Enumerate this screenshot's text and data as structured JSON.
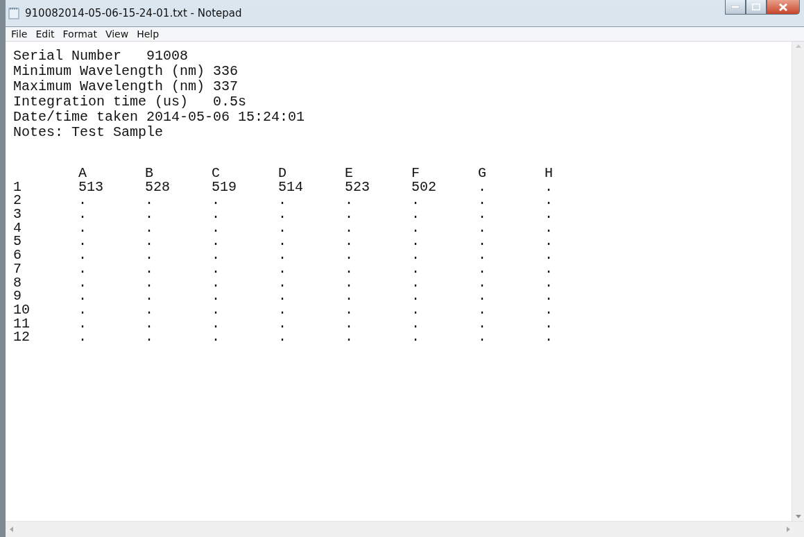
{
  "window": {
    "title": "910082014-05-06-15-24-01.txt - Notepad"
  },
  "menu": [
    "File",
    "Edit",
    "Format",
    "View",
    "Help"
  ],
  "document": {
    "lines": [
      "Serial Number   91008",
      "Minimum Wavelength (nm) 336",
      "Maximum Wavelength (nm) 337",
      "Integration time (us)   0.5s",
      "Date/time taken 2014-05-06 15:24:01",
      "Notes: Test Sample"
    ],
    "table": {
      "columns": [
        "A",
        "B",
        "C",
        "D",
        "E",
        "F",
        "G",
        "H"
      ],
      "rows": [
        {
          "label": "1",
          "cells": [
            "513",
            "528",
            "519",
            "514",
            "523",
            "502",
            ".",
            "."
          ]
        },
        {
          "label": "2",
          "cells": [
            ".",
            ".",
            ".",
            ".",
            ".",
            ".",
            ".",
            "."
          ]
        },
        {
          "label": "3",
          "cells": [
            ".",
            ".",
            ".",
            ".",
            ".",
            ".",
            ".",
            "."
          ]
        },
        {
          "label": "4",
          "cells": [
            ".",
            ".",
            ".",
            ".",
            ".",
            ".",
            ".",
            "."
          ]
        },
        {
          "label": "5",
          "cells": [
            ".",
            ".",
            ".",
            ".",
            ".",
            ".",
            ".",
            "."
          ]
        },
        {
          "label": "6",
          "cells": [
            ".",
            ".",
            ".",
            ".",
            ".",
            ".",
            ".",
            "."
          ]
        },
        {
          "label": "7",
          "cells": [
            ".",
            ".",
            ".",
            ".",
            ".",
            ".",
            ".",
            "."
          ]
        },
        {
          "label": "8",
          "cells": [
            ".",
            ".",
            ".",
            ".",
            ".",
            ".",
            ".",
            "."
          ]
        },
        {
          "label": "9",
          "cells": [
            ".",
            ".",
            ".",
            ".",
            ".",
            ".",
            ".",
            "."
          ]
        },
        {
          "label": "10",
          "cells": [
            ".",
            ".",
            ".",
            ".",
            ".",
            ".",
            ".",
            "."
          ]
        },
        {
          "label": "11",
          "cells": [
            ".",
            ".",
            ".",
            ".",
            ".",
            ".",
            ".",
            "."
          ]
        },
        {
          "label": "12",
          "cells": [
            ".",
            ".",
            ".",
            ".",
            ".",
            ".",
            ".",
            "."
          ]
        }
      ]
    }
  }
}
